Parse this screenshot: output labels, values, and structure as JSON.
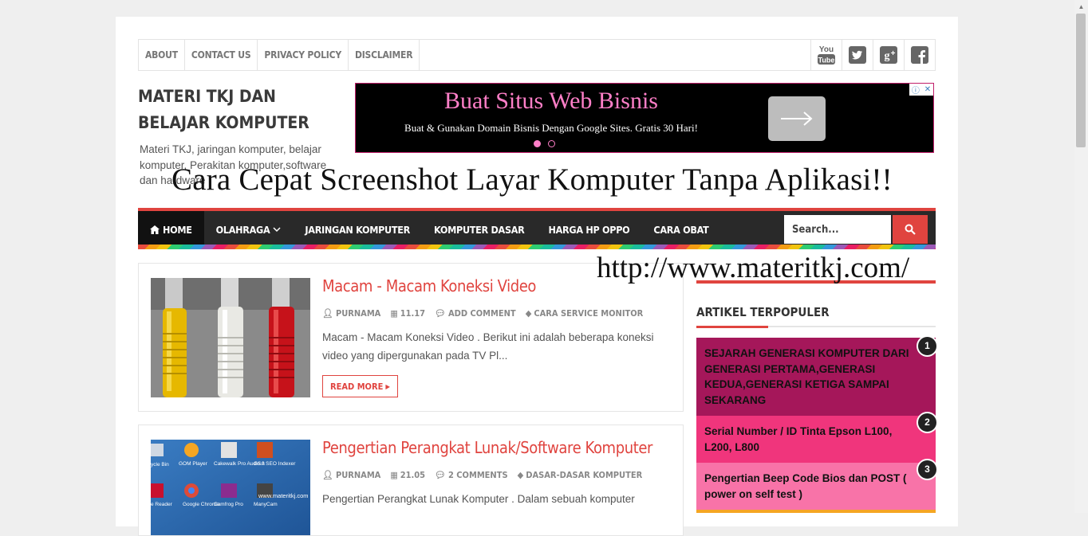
{
  "topnav": {
    "links": [
      "ABOUT",
      "CONTACT US",
      "PRIVACY POLICY",
      "DISCLAIMER"
    ],
    "social": [
      "youtube-icon",
      "twitter-icon",
      "google-plus-icon",
      "facebook-icon"
    ],
    "youtube_line1": "You",
    "youtube_line2": "Tube"
  },
  "site": {
    "title": "MATERI TKJ DAN BELAJAR KOMPUTER",
    "description": "Materi TKJ, jaringan komputer, belajar komputer, Perakitan komputer,software dan hardware"
  },
  "ad": {
    "title": "Buat Situs Web Bisnis",
    "text": "Buat & Gunakan Domain Bisnis Dengan Google Sites. Gratis 30 Hari!"
  },
  "overlay": {
    "title": "Cara Cepat Screenshot Layar Komputer Tanpa Aplikasi!!",
    "url": "http://www.materitkj.com/"
  },
  "mainnav": {
    "items": [
      "HOME",
      "OLAHRAGA",
      "JARINGAN KOMPUTER",
      "KOMPUTER DASAR",
      "HARGA HP OPPO",
      "CARA OBAT"
    ],
    "search_placeholder": "Search..."
  },
  "posts": [
    {
      "title": "Macam - Macam Koneksi Video",
      "author": "PURNAMA",
      "time": "11.17",
      "comments": "ADD COMMENT",
      "category": "CARA SERVICE MONITOR",
      "excerpt": "Macam - Macam Koneksi Video . Berikut ini adalah beberapa koneksi video yang dipergunakan pada TV Pl...",
      "readmore": "READ MORE"
    },
    {
      "title": "Pengertian Perangkat Lunak/Software Komputer",
      "author": "PURNAMA",
      "time": "21.05",
      "comments": "2 COMMENTS",
      "category": "DASAR-DASAR KOMPUTER",
      "excerpt": "Pengertian Perangkat Lunak Komputer . Dalam sebuah komputer",
      "thumb_icons": [
        "ycle Bin",
        "GOM Player",
        "Cakewalk Pro Audio 9",
        "GSA SEO Indexer",
        "e Reader",
        "Google Chrome",
        "Camfrog Pro",
        "ManyCam"
      ],
      "thumb_watermark": "www.materitkj.com"
    }
  ],
  "sidebar": {
    "widget_title": "ARTIKEL TERPOPULER",
    "popular": [
      {
        "rank": "1",
        "title": "SEJARAH GENERASI KOMPUTER DARI GENERASI PERTAMA,GENERASI KEDUA,GENERASI KETIGA SAMPAI SEKARANG"
      },
      {
        "rank": "2",
        "title": "Serial Number / ID Tinta Epson L100, L200, L800"
      },
      {
        "rank": "3",
        "title": "Pengertian Beep Code Bios dan POST ( power on self test )"
      }
    ]
  },
  "colors": {
    "accent": "#e0443f",
    "nav_bg": "#292929",
    "popular_1": "#a5175a",
    "popular_2": "#f0357c",
    "popular_3": "#f873a8"
  }
}
